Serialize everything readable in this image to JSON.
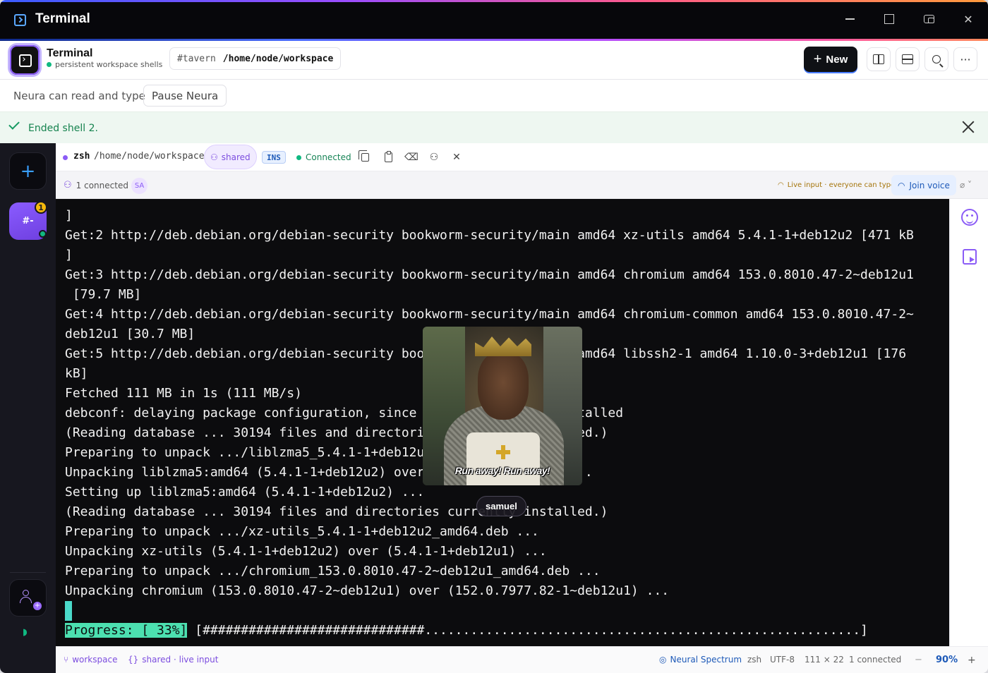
{
  "window": {
    "title": "Terminal"
  },
  "header": {
    "title": "Terminal",
    "subtitle": "persistent workspace shells",
    "channel": "#tavern",
    "path": "/home/node/workspace",
    "new_label": "New",
    "more_label": "···"
  },
  "neura": {
    "status": "Neura can read and type",
    "pause_label": "Pause Neura"
  },
  "notice": {
    "message": "Ended shell 2."
  },
  "rail": {
    "channel_label": "#-",
    "badge_count": "1"
  },
  "pane": {
    "shell": "zsh",
    "cwd": "/home/node/workspace",
    "shared_label": "shared",
    "mode": "INS",
    "connection": "Connected"
  },
  "presence": {
    "connected": "1 connected",
    "avatar_initials": "SA",
    "live_input": "Live input · everyone can type",
    "join_voice": "Join voice"
  },
  "terminal": {
    "lines": [
      "]",
      "Get:2 http://deb.debian.org/debian-security bookworm-security/main amd64 xz-utils amd64 5.4.1-1+deb12u2 [471 kB",
      "]",
      "Get:3 http://deb.debian.org/debian-security bookworm-security/main amd64 chromium amd64 153.0.8010.47-2~deb12u1",
      " [79.7 MB]",
      "Get:4 http://deb.debian.org/debian-security bookworm-security/main amd64 chromium-common amd64 153.0.8010.47-2~",
      "deb12u1 [30.7 MB]",
      "Get:5 http://deb.debian.org/debian-security bookworm-security/main amd64 libssh2-1 amd64 1.10.0-3+deb12u1 [176",
      "kB]",
      "Fetched 111 MB in 1s (111 MB/s)",
      "debconf: delaying package configuration, since apt-utils is not installed",
      "(Reading database ... 30194 files and directories currently installed.)",
      "Preparing to unpack .../liblzma5_5.4.1-1+deb12u2_amd64.deb ...",
      "Unpacking liblzma5:amd64 (5.4.1-1+deb12u2) over (5.4.1-1+deb12u1) ...",
      "Setting up liblzma5:amd64 (5.4.1-1+deb12u2) ...",
      "(Reading database ... 30194 files and directories currently installed.)",
      "Preparing to unpack .../xz-utils_5.4.1-1+deb12u2_amd64.deb ...",
      "Unpacking xz-utils (5.4.1-1+deb12u2) over (5.4.1-1+deb12u1) ...",
      "Preparing to unpack .../chromium_153.0.8010.47-2~deb12u1_amd64.deb ...",
      "Unpacking chromium (153.0.8010.47-2~deb12u1) over (152.0.7977.82-1~deb12u1) ..."
    ],
    "progress_label": "Progress: [ 33%]",
    "progress_bar": " [#############################.........................................................]"
  },
  "video": {
    "caption": "Run away! Run away!",
    "participant": "samuel"
  },
  "status": {
    "workspace": "workspace",
    "shared": "shared · live input",
    "theme": "Neural Spectrum",
    "shell": "zsh",
    "encoding": "UTF-8",
    "size": "111 × 22",
    "connected": "1 connected",
    "zoom_out": "−",
    "zoom": "90%",
    "zoom_in": "+"
  },
  "colors": {
    "accent": "#8b5cf6",
    "terminal_bg": "#0c0c0e",
    "success": "#10b981",
    "progress_highlight": "#4ce0b0"
  }
}
